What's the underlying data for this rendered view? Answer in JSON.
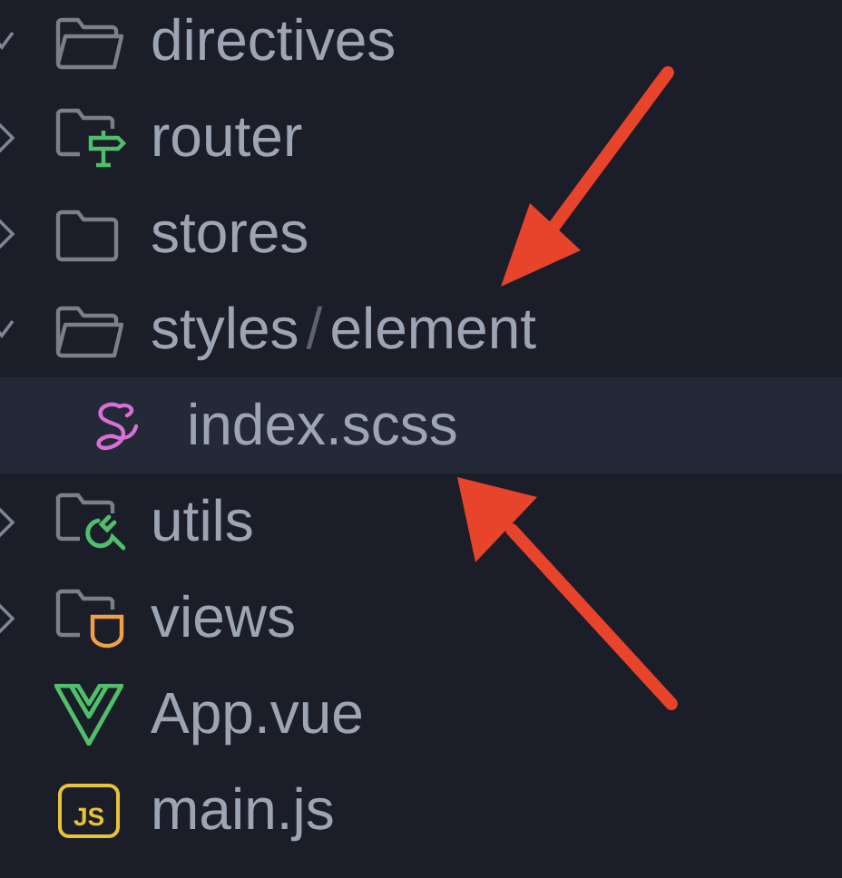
{
  "explorer": {
    "items": [
      {
        "kind": "folder",
        "segments": [
          "directives"
        ],
        "expanded": true,
        "selected": false
      },
      {
        "kind": "router-folder",
        "segments": [
          "router"
        ],
        "expanded": false,
        "selected": false
      },
      {
        "kind": "folder",
        "segments": [
          "stores"
        ],
        "expanded": false,
        "selected": false
      },
      {
        "kind": "folder",
        "segments": [
          "styles",
          "element"
        ],
        "separator": "/",
        "expanded": true,
        "selected": false,
        "children": [
          {
            "kind": "sass-file",
            "segments": [
              "index.scss"
            ],
            "selected": true
          }
        ]
      },
      {
        "kind": "utils-folder",
        "segments": [
          "utils"
        ],
        "expanded": false,
        "selected": false
      },
      {
        "kind": "views-folder",
        "segments": [
          "views"
        ],
        "expanded": false,
        "selected": false
      },
      {
        "kind": "vue-file",
        "segments": [
          "App.vue"
        ],
        "selected": false
      },
      {
        "kind": "js-file",
        "icon_text": "JS",
        "segments": [
          "main.js"
        ],
        "selected": false
      }
    ]
  }
}
